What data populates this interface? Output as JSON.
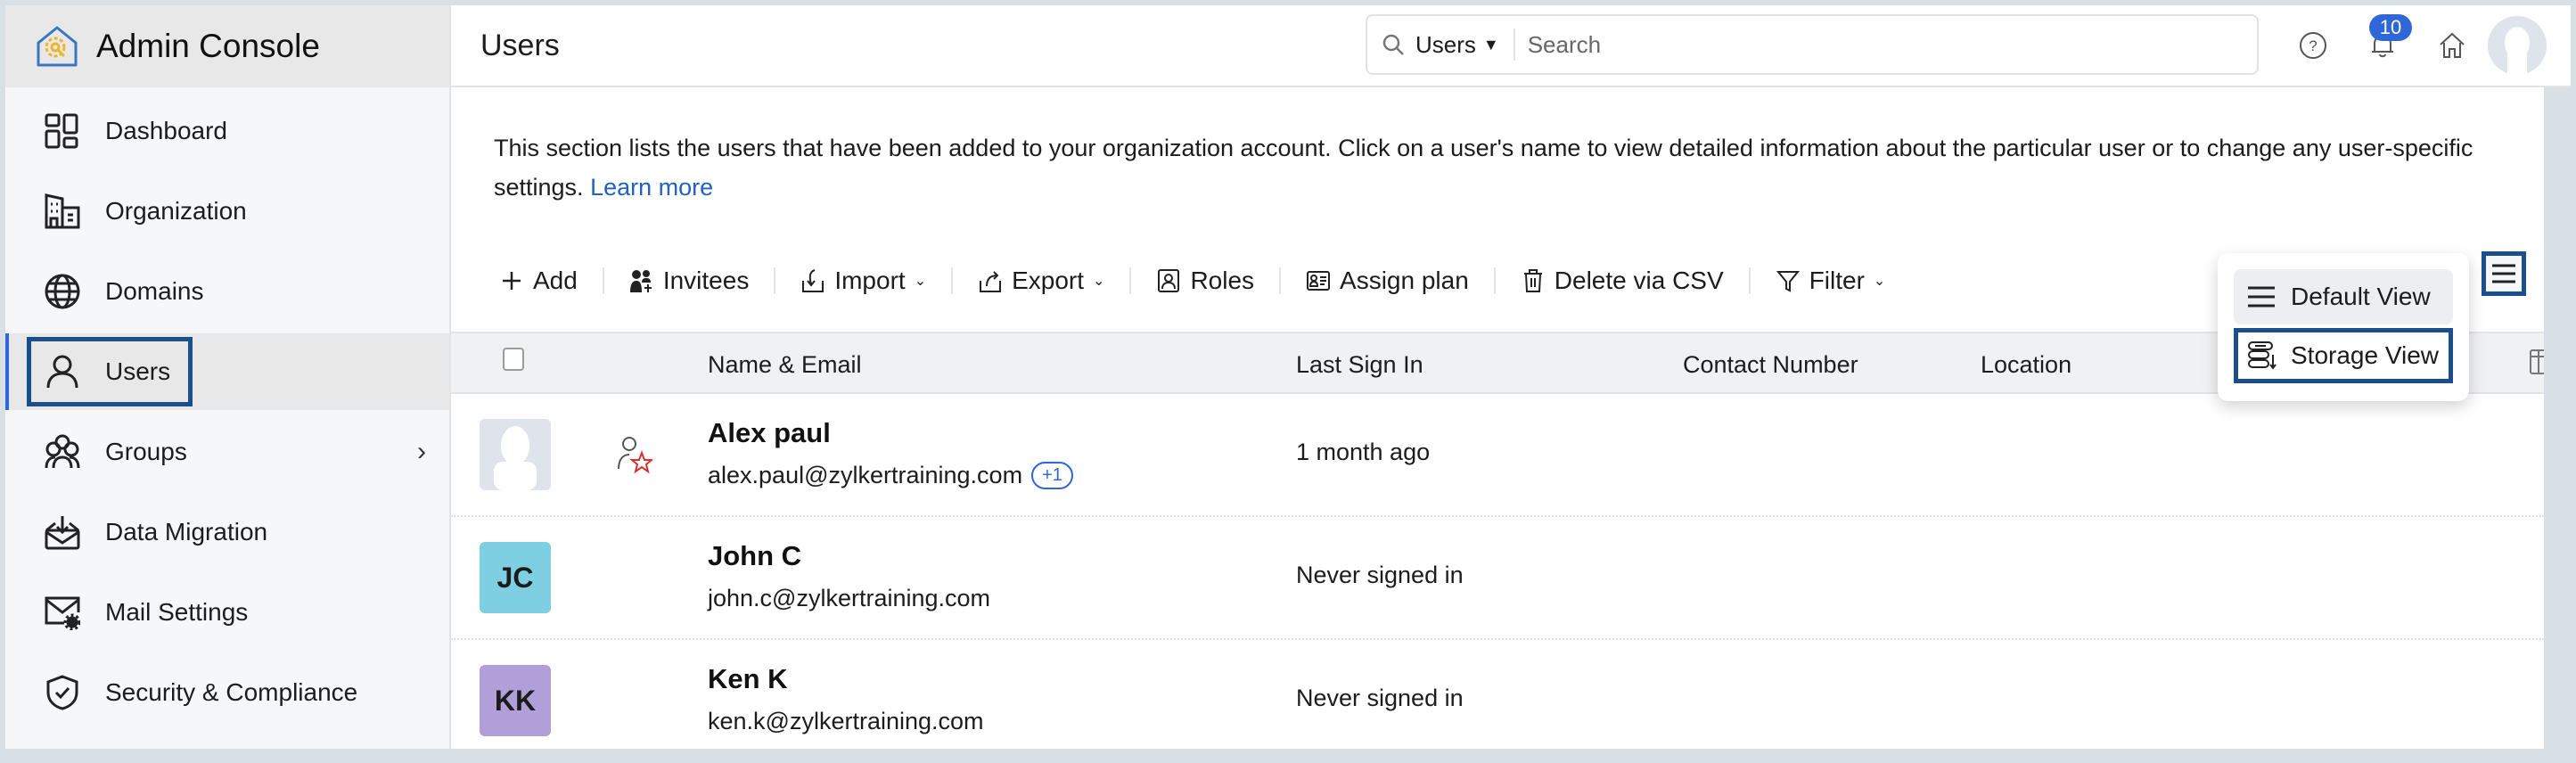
{
  "app": {
    "title": "Admin Console",
    "logo_icon": "admin-console-logo-icon"
  },
  "sidebar": {
    "items": [
      {
        "label": "Dashboard",
        "icon": "dashboard-icon"
      },
      {
        "label": "Organization",
        "icon": "building-icon"
      },
      {
        "label": "Domains",
        "icon": "globe-icon"
      },
      {
        "label": "Users",
        "icon": "user-icon",
        "active": true
      },
      {
        "label": "Groups",
        "icon": "group-icon",
        "has_submenu": true
      },
      {
        "label": "Data Migration",
        "icon": "mail-download-icon"
      },
      {
        "label": "Mail Settings",
        "icon": "mail-gear-icon"
      },
      {
        "label": "Security & Compliance",
        "icon": "shield-check-icon"
      }
    ]
  },
  "header": {
    "page_title": "Users",
    "search_scope": "Users",
    "search_placeholder": "Search",
    "notification_count": "10"
  },
  "description": {
    "text": "This section lists the users that have been added to your organization account. Click on a user's name to view detailed information about the particular user or to change any user-specific settings.",
    "link": "Learn more"
  },
  "toolbar": {
    "add": "Add",
    "invitees": "Invitees",
    "import": "Import",
    "export": "Export",
    "roles": "Roles",
    "assign_plan": "Assign plan",
    "delete_csv": "Delete via CSV",
    "filter": "Filter"
  },
  "view_menu": {
    "items": [
      {
        "label": "Default View",
        "icon": "list-icon"
      },
      {
        "label": "Storage View",
        "icon": "storage-icon"
      }
    ]
  },
  "table": {
    "columns": [
      "Name & Email",
      "Last Sign In",
      "Contact Number",
      "Location"
    ],
    "rows": [
      {
        "name": "Alex paul",
        "email": "alex.paul@zylkertraining.com",
        "extra_emails": "+1",
        "last_sign_in": "1 month ago",
        "initials": "",
        "avatar_color": "#dfe3ec",
        "role": "super-admin"
      },
      {
        "name": "John C",
        "email": "john.c@zylkertraining.com",
        "extra_emails": "",
        "last_sign_in": "Never signed in",
        "initials": "JC",
        "avatar_color": "#7dcfe1"
      },
      {
        "name": "Ken K",
        "email": "ken.k@zylkertraining.com",
        "extra_emails": "",
        "last_sign_in": "Never signed in",
        "initials": "KK",
        "avatar_color": "#b09fd9"
      }
    ]
  },
  "colors": {
    "accent": "#2f67d8",
    "highlight": "#1b4f8c",
    "link": "#2160c4"
  }
}
